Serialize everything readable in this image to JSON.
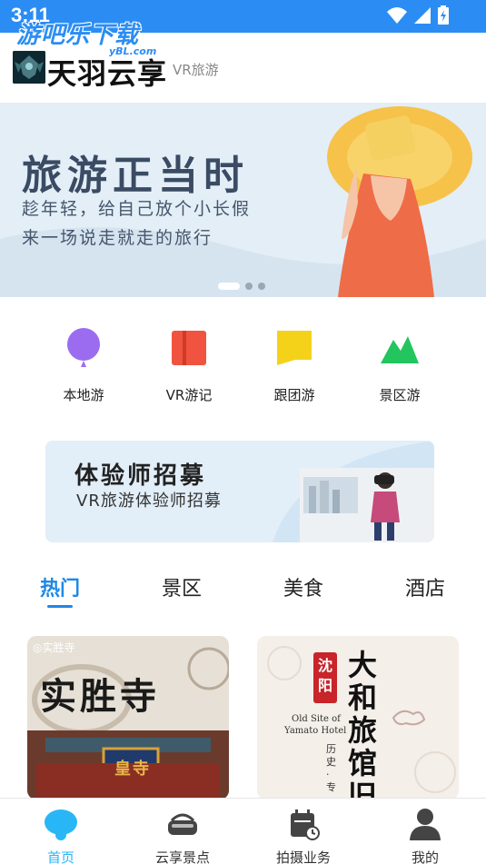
{
  "status_bar": {
    "time": "3:11"
  },
  "watermark": {
    "text": "游吧乐下载",
    "sub": "yBL.com"
  },
  "header": {
    "app_name": "天羽云享",
    "app_sub": "VR旅游"
  },
  "banner": {
    "title": "旅游正当时",
    "line1": "趁年轻，给自己放个小长假",
    "line2": "来一场说走就走的旅行",
    "dots": 3,
    "active_dot": 1
  },
  "categories": [
    {
      "label": "本地游",
      "icon": "balloon-icon",
      "color": "#9b6cf0"
    },
    {
      "label": "VR游记",
      "icon": "book-icon",
      "color": "#f0533f"
    },
    {
      "label": "跟团游",
      "icon": "flag-icon",
      "color": "#f5d21a"
    },
    {
      "label": "景区游",
      "icon": "mountain-icon",
      "color": "#22c55e"
    }
  ],
  "recruit": {
    "title": "体验师招募",
    "subtitle": "VR旅游体验师招募"
  },
  "tabs": [
    {
      "label": "热门",
      "active": true
    },
    {
      "label": "景区",
      "active": false
    },
    {
      "label": "美食",
      "active": false
    },
    {
      "label": "酒店",
      "active": false
    }
  ],
  "cards": [
    {
      "tag": "◎实胜寺",
      "title": "实胜寺",
      "plaque": "皇寺"
    },
    {
      "seal": "沈阳",
      "title": "大和旅馆旧",
      "en_line1": "Old Site of",
      "en_line2": "Yamato Hotel",
      "side": "历史·专"
    }
  ],
  "bottom_nav": [
    {
      "label": "首页",
      "icon": "home-icon",
      "active": true
    },
    {
      "label": "云享景点",
      "icon": "vr-headset-icon",
      "active": false
    },
    {
      "label": "拍摄业务",
      "icon": "calendar-icon",
      "active": false
    },
    {
      "label": "我的",
      "icon": "user-icon",
      "active": false
    }
  ],
  "colors": {
    "accent": "#1e88e5",
    "status_bar": "#2b8df3",
    "nav_active": "#29b6f6"
  }
}
